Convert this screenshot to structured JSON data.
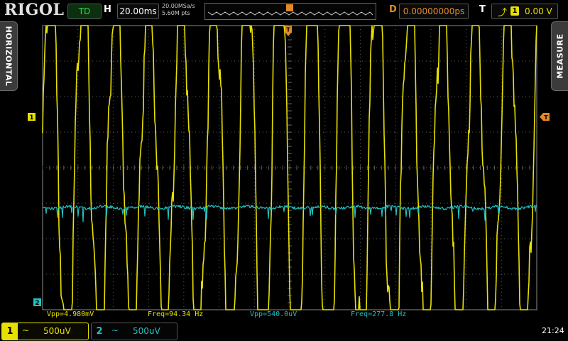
{
  "brand": "RIGOL",
  "top": {
    "mode": "TD",
    "timebase_label": "H",
    "timebase": "20.00ms",
    "sample_rate": "20.00MSa/s",
    "mem_depth": "5.60M pts",
    "delay_label": "D",
    "delay": "0.00000000ps",
    "trigger_label": "T",
    "trigger_edge": "rising-edge-icon",
    "trigger_source": "1",
    "trigger_level": "0.00 V"
  },
  "side": {
    "left": "HORIZONTAL",
    "right": "MEASURE"
  },
  "markers": {
    "trigger": "T",
    "ch1": "1",
    "ch2": "2"
  },
  "measurements": [
    {
      "text": "Vpp=4.980mV",
      "channel": "1"
    },
    {
      "text": "Freq=94.34 Hz",
      "channel": "1"
    },
    {
      "text": "Vpp=540.0uV",
      "channel": "2"
    },
    {
      "text": "Freq=277.8 Hz",
      "channel": "2"
    }
  ],
  "channels": [
    {
      "num": "1",
      "coupling": "~",
      "scale": "500uV",
      "color": "#e8e000"
    },
    {
      "num": "2",
      "coupling": "~",
      "scale": "500uV",
      "color": "#20c0c0"
    }
  ],
  "clock": "21:24",
  "colors": {
    "ch1": "#e8e000",
    "ch2": "#20c0c0",
    "delay": "#e08a2a",
    "grid": "#606060"
  }
}
